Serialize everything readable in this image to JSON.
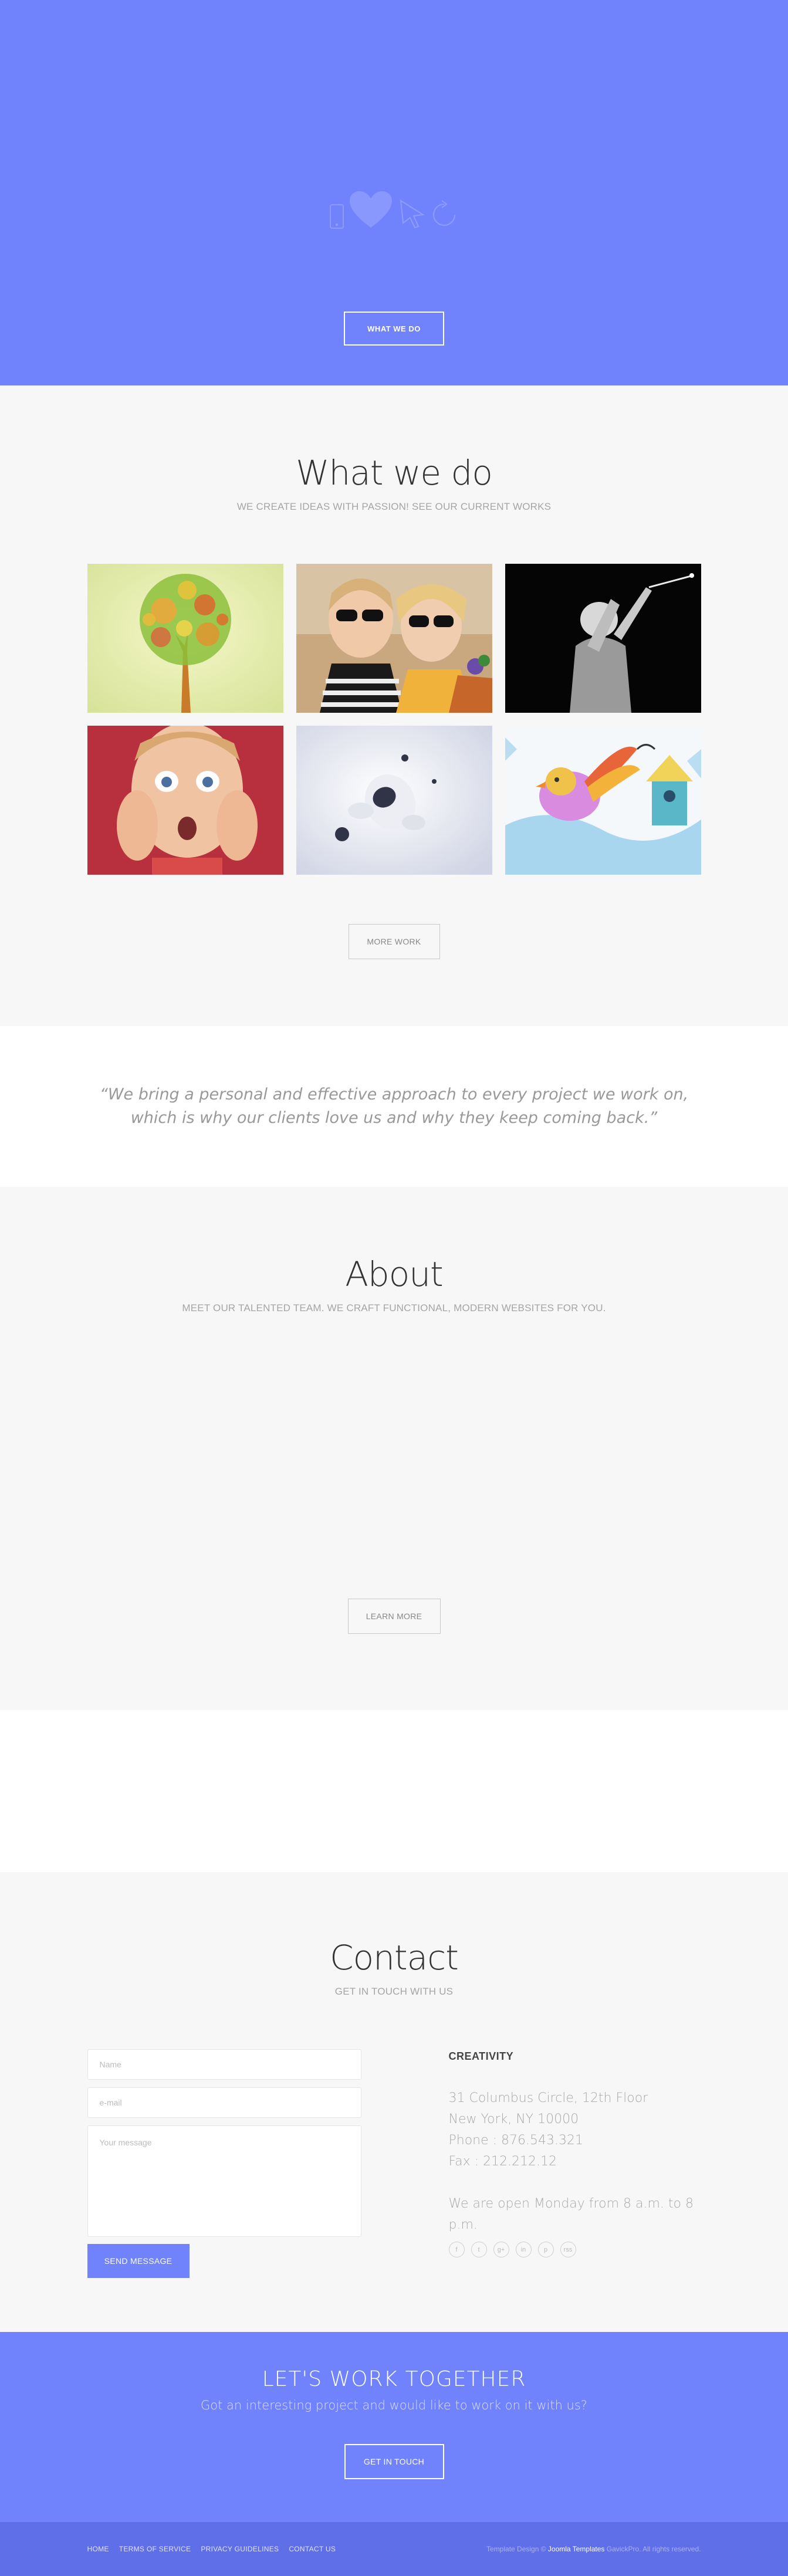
{
  "hero": {
    "button_label": "WHAT WE DO",
    "icons": [
      "mobile-icon",
      "heart-icon",
      "cursor-icon",
      "refresh-icon"
    ]
  },
  "what_we_do": {
    "title": "What we do",
    "subtitle": "WE CREATE IDEAS WITH PASSION! SEE OUR CURRENT WORKS",
    "portfolio": [
      "tree illustration",
      "two women in sunglasses",
      "golfer",
      "surprised child",
      "astronaut",
      "bird and birdhouse illustration"
    ],
    "more_button": "MORE WORK"
  },
  "quote": {
    "text": "“We bring a personal and effective approach to every project we work on, which is why our clients love us and why they keep coming back.”"
  },
  "about": {
    "title": "About",
    "subtitle": "MEET OUR TALENTED TEAM. WE CRAFT FUNCTIONAL, MODERN WEBSITES FOR YOU.",
    "learn_button": "LEARN MORE"
  },
  "contact": {
    "title": "Contact",
    "subtitle": "GET IN TOUCH WITH US",
    "form": {
      "name_placeholder": "Name",
      "email_placeholder": "e-mail",
      "message_placeholder": "Your message",
      "send_button": "SEND MESSAGE"
    },
    "info": {
      "company": "CREATIVITY",
      "address1": "31 Columbus Circle, 12th Floor",
      "address2": "New York, NY 10000",
      "phone": "Phone : 876.543.321",
      "fax": "Fax : 212.212.12",
      "hours": "We are open Monday from 8 a.m. to 8 p.m."
    },
    "socials": [
      {
        "icon": "facebook-icon",
        "glyph": "f"
      },
      {
        "icon": "twitter-icon",
        "glyph": "t"
      },
      {
        "icon": "google-plus-icon",
        "glyph": "g+"
      },
      {
        "icon": "linkedin-icon",
        "glyph": "in"
      },
      {
        "icon": "pinterest-icon",
        "glyph": "p"
      },
      {
        "icon": "rss-icon",
        "glyph": "rss"
      }
    ]
  },
  "cta": {
    "title": "LET'S WORK TOGETHER",
    "text": "Got an interesting project and would like to work on it with us?",
    "button": "GET IN TOUCH"
  },
  "footer": {
    "links": [
      "HOME",
      "TERMS OF SERVICE",
      "PRIVACY GUIDELINES",
      "CONTACT US"
    ],
    "copy_prefix": "Template Design ©",
    "copy_brand": "Joomla Templates",
    "copy_suffix": "GavickPro. All rights reserved."
  },
  "colors": {
    "accent": "#7183fc",
    "footer": "#5f6fe7",
    "section_bg": "#f7f7f7"
  }
}
